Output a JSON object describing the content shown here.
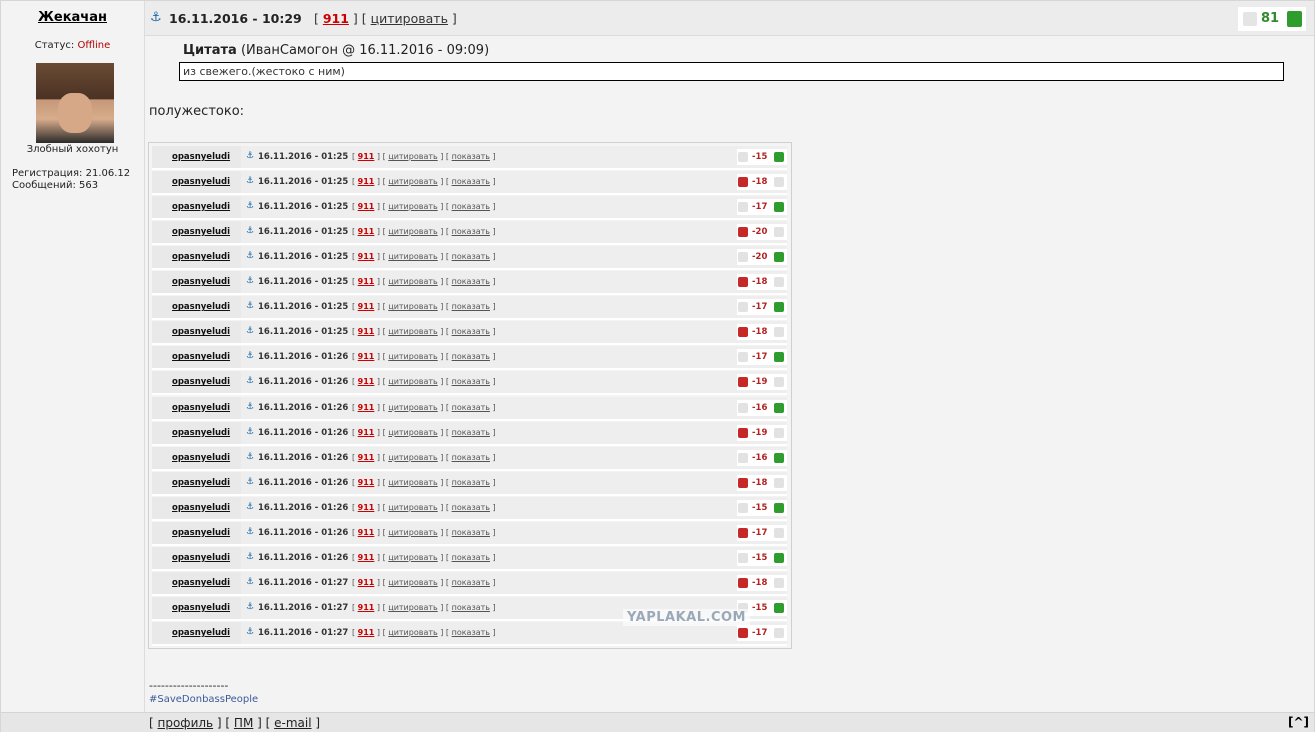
{
  "post": {
    "author": "Жекачан",
    "date": "16.11.2016 - 10:29",
    "link_911": "911",
    "quote_link": "цитировать",
    "rating": "81",
    "status_label": "Статус:",
    "status_value": "Offline",
    "user_title": "Злобный хохотун",
    "registration": "Регистрация: 21.06.12",
    "messages": "Сообщений: 563",
    "quote_title": "Цитата",
    "quote_meta": "(ИванСамогон @ 16.11.2016 - 09:09)",
    "quote_text": "из свежего.(жестоко с ним)",
    "body_text": "полужестоко:",
    "signature_dashes": "--------------------",
    "signature_tag": "#SaveDonbassPeople"
  },
  "screenshot": {
    "watermark": "YAPLAKAL.COM",
    "link_911": "911",
    "quote_label": "цитировать",
    "show_label": "показать",
    "rows": [
      {
        "user": "opasnyeludi",
        "date": "16.11.2016 - 01:25",
        "score": "-15",
        "vote": "up"
      },
      {
        "user": "opasnyeludi",
        "date": "16.11.2016 - 01:25",
        "score": "-18",
        "vote": "down"
      },
      {
        "user": "opasnyeludi",
        "date": "16.11.2016 - 01:25",
        "score": "-17",
        "vote": "up"
      },
      {
        "user": "opasnyeludi",
        "date": "16.11.2016 - 01:25",
        "score": "-20",
        "vote": "down"
      },
      {
        "user": "opasnyeludi",
        "date": "16.11.2016 - 01:25",
        "score": "-20",
        "vote": "up"
      },
      {
        "user": "opasnyeludi",
        "date": "16.11.2016 - 01:25",
        "score": "-18",
        "vote": "down"
      },
      {
        "user": "opasnyeludi",
        "date": "16.11.2016 - 01:25",
        "score": "-17",
        "vote": "up"
      },
      {
        "user": "opasnyeludi",
        "date": "16.11.2016 - 01:25",
        "score": "-18",
        "vote": "down"
      },
      {
        "user": "opasnyeludi",
        "date": "16.11.2016 - 01:26",
        "score": "-17",
        "vote": "up"
      },
      {
        "user": "opasnyeludi",
        "date": "16.11.2016 - 01:26",
        "score": "-19",
        "vote": "down"
      },
      {
        "user": "opasnyeludi",
        "date": "16.11.2016 - 01:26",
        "score": "-16",
        "vote": "up"
      },
      {
        "user": "opasnyeludi",
        "date": "16.11.2016 - 01:26",
        "score": "-19",
        "vote": "down"
      },
      {
        "user": "opasnyeludi",
        "date": "16.11.2016 - 01:26",
        "score": "-16",
        "vote": "up"
      },
      {
        "user": "opasnyeludi",
        "date": "16.11.2016 - 01:26",
        "score": "-18",
        "vote": "down"
      },
      {
        "user": "opasnyeludi",
        "date": "16.11.2016 - 01:26",
        "score": "-15",
        "vote": "up"
      },
      {
        "user": "opasnyeludi",
        "date": "16.11.2016 - 01:26",
        "score": "-17",
        "vote": "down"
      },
      {
        "user": "opasnyeludi",
        "date": "16.11.2016 - 01:26",
        "score": "-15",
        "vote": "up"
      },
      {
        "user": "opasnyeludi",
        "date": "16.11.2016 - 01:27",
        "score": "-18",
        "vote": "down"
      },
      {
        "user": "opasnyeludi",
        "date": "16.11.2016 - 01:27",
        "score": "-15",
        "vote": "up"
      },
      {
        "user": "opasnyeludi",
        "date": "16.11.2016 - 01:27",
        "score": "-17",
        "vote": "down"
      }
    ]
  },
  "footer": {
    "profile": "профиль",
    "pm": "ПМ",
    "email": "e-mail",
    "up": "^"
  },
  "icons": {
    "anchor": "anchor-icon",
    "thumb_down": "thumb-down-icon",
    "thumb_up": "thumb-up-icon"
  },
  "colors": {
    "link_911": "#cc0000",
    "rating_positive": "#2e8b2e",
    "status_offline": "#b00000",
    "score_negative": "#b22222"
  }
}
